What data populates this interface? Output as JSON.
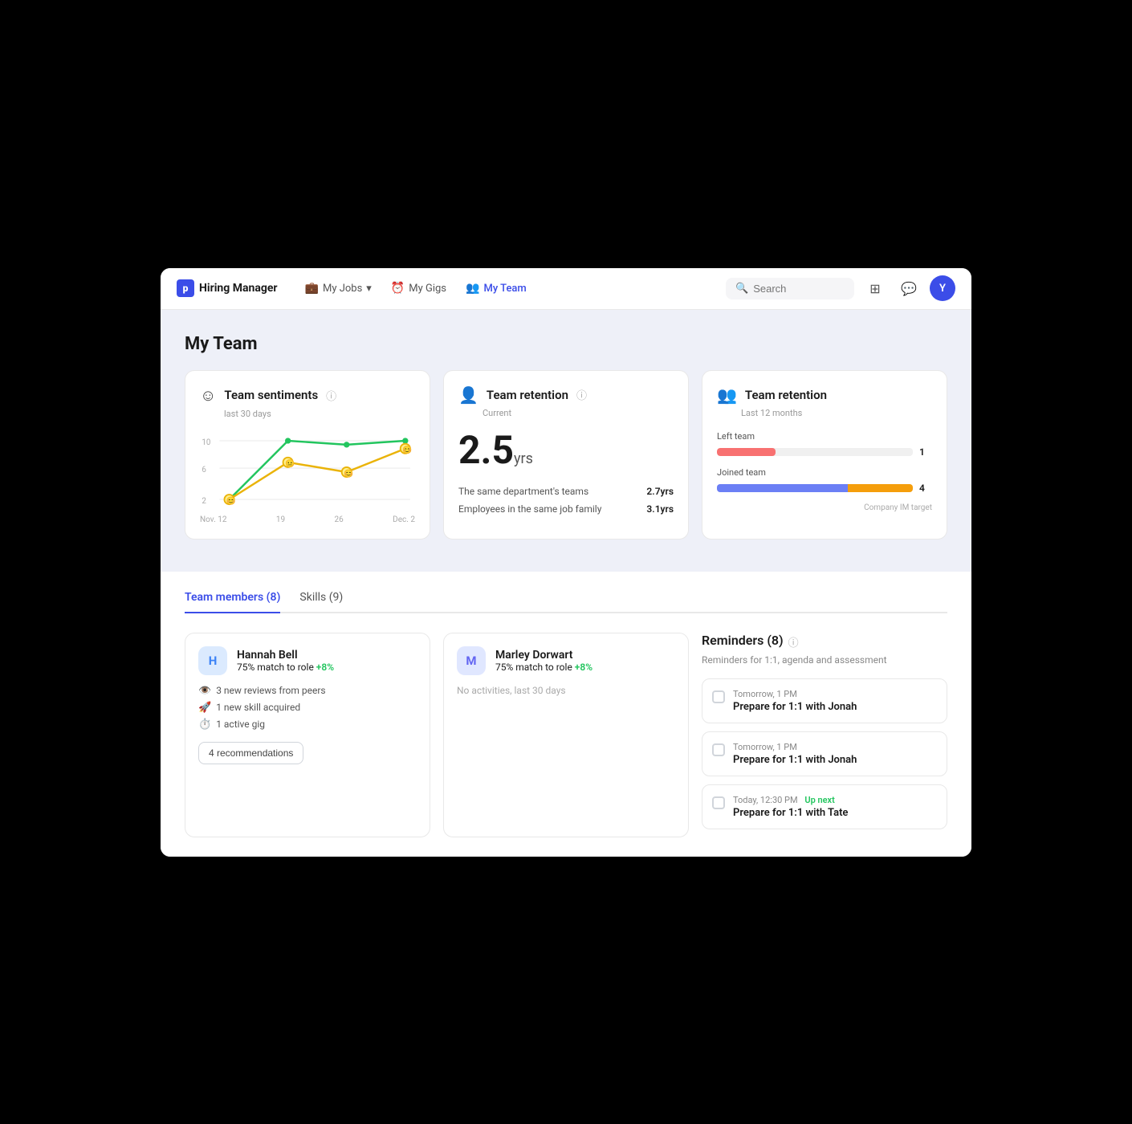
{
  "brand": {
    "icon_letter": "p",
    "name": "Hiring Manager"
  },
  "nav": {
    "links": [
      {
        "id": "my-jobs",
        "label": "My Jobs",
        "icon": "💼",
        "has_dropdown": true,
        "active": false
      },
      {
        "id": "my-gigs",
        "label": "My Gigs",
        "icon": "⏰",
        "has_dropdown": false,
        "active": false
      },
      {
        "id": "my-team",
        "label": "My Team",
        "icon": "👥",
        "has_dropdown": false,
        "active": true
      }
    ],
    "search_placeholder": "Search",
    "avatar_letter": "Y"
  },
  "hero": {
    "title": "My Team",
    "card_sentiments": {
      "title": "Team sentiments",
      "subtitle": "last 30 days",
      "chart": {
        "x_labels": [
          "Nov. 12",
          "19",
          "26",
          "Dec. 2"
        ],
        "y_labels": [
          "10",
          "6",
          "2"
        ],
        "green_points": [
          2,
          10,
          9,
          10
        ],
        "yellow_points": [
          2,
          7,
          6,
          9
        ]
      }
    },
    "card_retention_current": {
      "title": "Team retention",
      "subtitle": "Current",
      "value": "2.5",
      "unit": "yrs",
      "stats": [
        {
          "label": "The same department's teams",
          "value": "2.7yrs"
        },
        {
          "label": "Employees in the same job family",
          "value": "3.1yrs"
        }
      ]
    },
    "card_retention_12months": {
      "title": "Team retention",
      "subtitle": "Last 12 months",
      "left_team_label": "Left team",
      "left_team_value": "1",
      "left_bar_width": 30,
      "joined_team_label": "Joined team",
      "joined_team_value": "4",
      "joined_bar_blue_width": 60,
      "joined_bar_orange_width": 30,
      "target_label": "Company IM target"
    }
  },
  "main": {
    "tabs": [
      {
        "id": "team-members",
        "label": "Team members (8)",
        "active": true
      },
      {
        "id": "skills",
        "label": "Skills (9)",
        "active": false
      }
    ],
    "members": [
      {
        "id": "hannah-bell",
        "avatar_letter": "H",
        "avatar_class": "avatar-h",
        "name": "Hannah Bell",
        "match": "75% match to role",
        "match_plus": "+8%",
        "activities": [
          {
            "icon": "👁️",
            "text": "3 new reviews from peers"
          },
          {
            "icon": "🚀",
            "text": "1 new skill acquired"
          },
          {
            "icon": "⏱️",
            "text": "1 active gig"
          }
        ],
        "rec_label": "4 recommendations",
        "no_activity": false
      },
      {
        "id": "marley-dorwart",
        "avatar_letter": "M",
        "avatar_class": "avatar-m",
        "name": "Marley Dorwart",
        "match": "75% match to role",
        "match_plus": "+8%",
        "activities": [],
        "no_activity": true,
        "no_activity_text": "No activities, last 30 days"
      }
    ],
    "reminders": {
      "title": "Reminders (8)",
      "subtitle": "Reminders for 1:1, agenda and assessment",
      "items": [
        {
          "id": "r1",
          "time": "Tomorrow, 1 PM",
          "up_next": false,
          "title": "Prepare for 1:1 with Jonah"
        },
        {
          "id": "r2",
          "time": "Tomorrow, 1 PM",
          "up_next": false,
          "title": "Prepare for 1:1 with Jonah"
        },
        {
          "id": "r3",
          "time": "Today, 12:30 PM",
          "up_next": true,
          "up_next_label": "Up next",
          "title": "Prepare for 1:1 with Tate"
        }
      ]
    }
  }
}
